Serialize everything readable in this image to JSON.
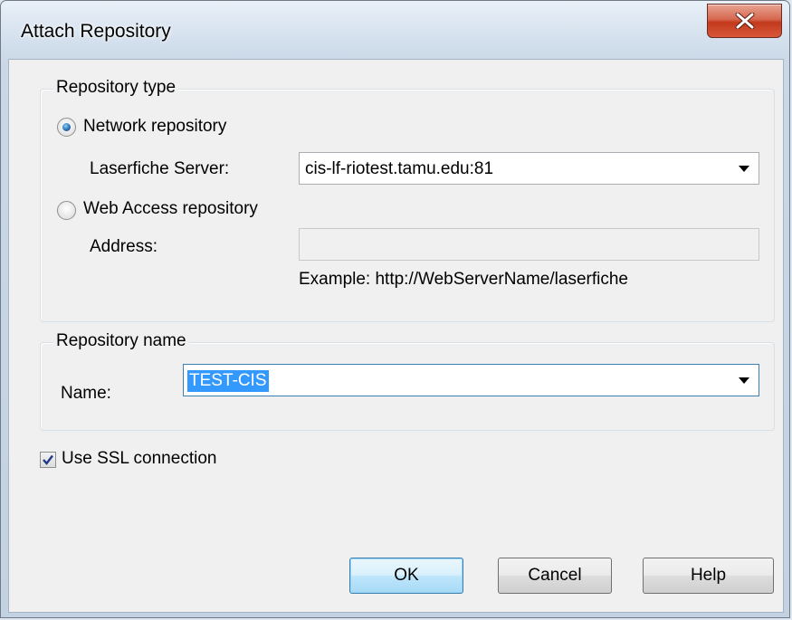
{
  "window": {
    "title": "Attach Repository"
  },
  "repository_type": {
    "legend": "Repository type",
    "network_radio_label": "Network repository",
    "network_selected": true,
    "server_label": "Laserfiche Server:",
    "server_value": "cis-lf-riotest.tamu.edu:81",
    "web_radio_label": "Web Access repository",
    "web_selected": false,
    "address_label": "Address:",
    "address_value": "",
    "example_text": "Example: http://WebServerName/laserfiche"
  },
  "repository_name": {
    "legend": "Repository name",
    "name_label": "Name:",
    "name_value": "TEST-CIS"
  },
  "ssl": {
    "label": "Use SSL connection",
    "checked": true
  },
  "buttons": {
    "ok": "OK",
    "cancel": "Cancel",
    "help": "Help"
  },
  "icons": {
    "close": "close-icon",
    "check": "check-icon",
    "dropdown": "chevron-down-icon"
  },
  "colors": {
    "selection": "#3399ff",
    "close_button": "#c2391c"
  }
}
